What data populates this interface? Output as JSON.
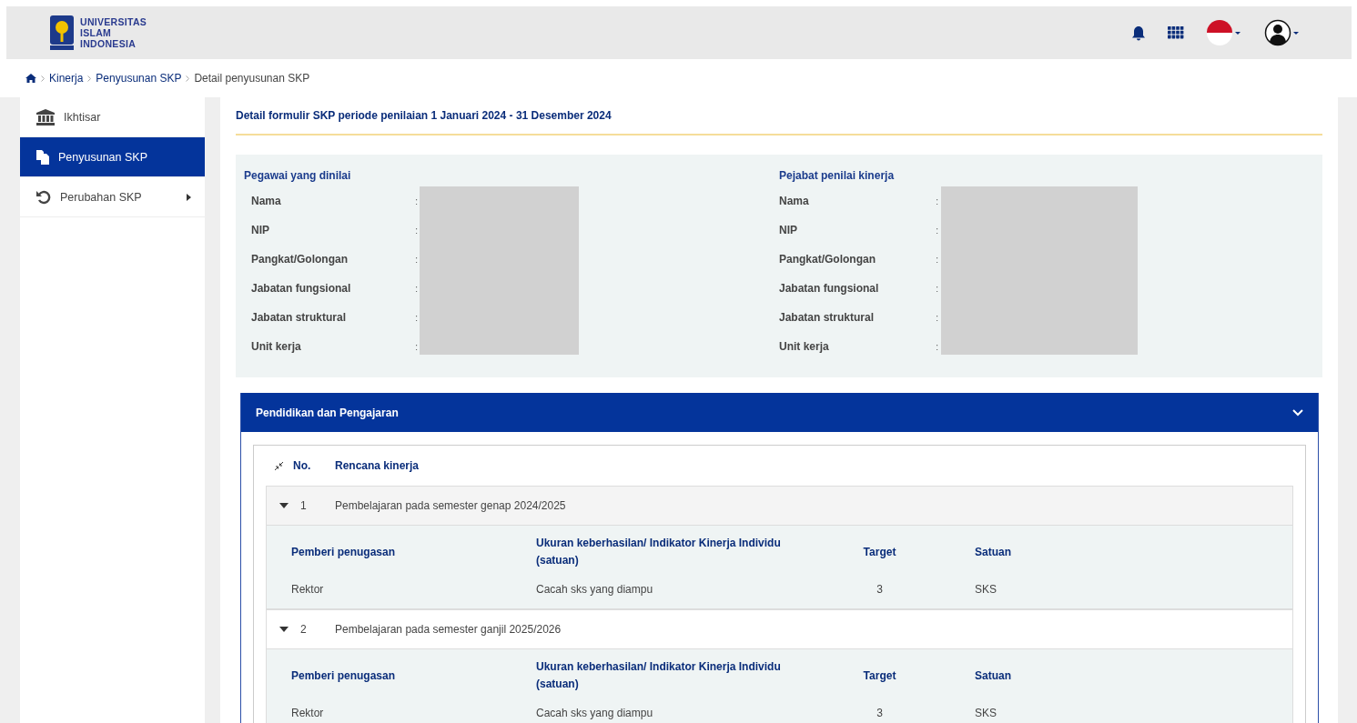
{
  "header": {
    "logo_lines": [
      "UNIVERSITAS",
      "ISLAM",
      "INDONESIA"
    ]
  },
  "breadcrumb": [
    {
      "label": "Kinerja",
      "link": true
    },
    {
      "label": "Penyusunan SKP",
      "link": true
    },
    {
      "label": "Detail penyusunan SKP",
      "link": false
    }
  ],
  "sidebar": {
    "items": [
      {
        "label": "Ikhtisar",
        "selected": false,
        "submenu": false
      },
      {
        "label": "Penyusunan SKP",
        "selected": true,
        "submenu": false
      },
      {
        "label": "Perubahan SKP",
        "selected": false,
        "submenu": true
      }
    ]
  },
  "page_title": "Detail formulir SKP periode penilaian 1 Januari 2024 - 31 Desember 2024",
  "panels": [
    {
      "title": "Pegawai yang dinilai",
      "fields": [
        {
          "label": "Nama",
          "separator": ":"
        },
        {
          "label": "NIP",
          "separator": ":"
        },
        {
          "label": "Pangkat/Golongan",
          "separator": ":"
        },
        {
          "label": "Jabatan fungsional",
          "separator": ":"
        },
        {
          "label": "Jabatan struktural",
          "separator": ":"
        },
        {
          "label": "Unit kerja",
          "separator": ":"
        }
      ]
    },
    {
      "title": "Pejabat penilai kinerja",
      "fields": [
        {
          "label": "Nama",
          "separator": ":"
        },
        {
          "label": "NIP",
          "separator": ":"
        },
        {
          "label": "Pangkat/Golongan",
          "separator": ":"
        },
        {
          "label": "Jabatan fungsional",
          "separator": ":"
        },
        {
          "label": "Jabatan struktural",
          "separator": ":"
        },
        {
          "label": "Unit kerja",
          "separator": ":"
        }
      ]
    }
  ],
  "section": {
    "title": "Pendidikan dan Pengajaran",
    "expanded": true,
    "columns": [
      "No.",
      "Rencana kinerja"
    ],
    "rows": [
      {
        "no": "1",
        "title": "Pembelajaran pada semester genap 2024/2025",
        "expanded": true,
        "detail_columns": [
          "Pemberi penugasan",
          "Ukuran keberhasilan/ Indikator Kinerja Individu (satuan)",
          "Target",
          "Satuan"
        ],
        "details": [
          {
            "giver": "Rektor",
            "indicator": "Cacah sks yang diampu",
            "target": "3",
            "unit": "SKS"
          }
        ]
      },
      {
        "no": "2",
        "title": "Pembelajaran pada semester ganjil 2025/2026",
        "expanded": true,
        "detail_columns": [
          "Pemberi penugasan",
          "Ukuran keberhasilan/ Indikator Kinerja Individu (satuan)",
          "Target",
          "Satuan"
        ],
        "details": [
          {
            "giver": "Rektor",
            "indicator": "Cacah sks yang diampu",
            "target": "3",
            "unit": "SKS"
          }
        ]
      }
    ]
  }
}
